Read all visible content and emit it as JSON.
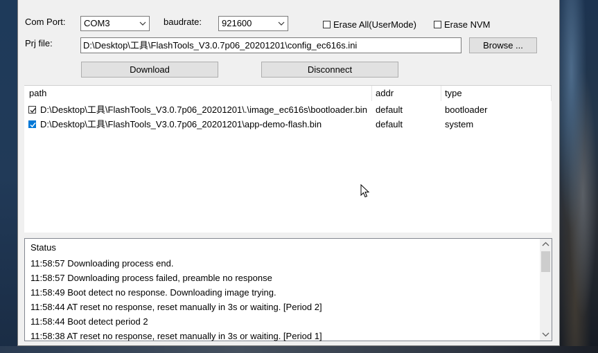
{
  "form": {
    "com_port_label": "Com Port:",
    "com_port_value": "COM3",
    "baudrate_label": "baudrate:",
    "baudrate_value": "921600",
    "erase_all_label": "Erase All(UserMode)",
    "erase_nvm_label": "Erase NVM",
    "prj_file_label": "Prj file:",
    "prj_file_value": "D:\\Desktop\\工具\\FlashTools_V3.0.7p06_20201201\\config_ec616s.ini",
    "browse_label": "Browse ...",
    "download_label": "Download",
    "disconnect_label": "Disconnect"
  },
  "file_list": {
    "columns": [
      "path",
      "addr",
      "type"
    ],
    "rows": [
      {
        "path": "D:\\Desktop\\工具\\FlashTools_V3.0.7p06_20201201\\.\\image_ec616s\\bootloader.bin",
        "addr": "default",
        "type": "bootloader",
        "checked": true
      },
      {
        "path": "D:\\Desktop\\工具\\FlashTools_V3.0.7p06_20201201\\app-demo-flash.bin",
        "addr": "default",
        "type": "system",
        "checked": true
      }
    ]
  },
  "status": {
    "title": "Status",
    "lines": [
      "11:58:57 Downloading process end.",
      "11:58:57 Downloading process failed, preamble no response",
      "11:58:49 Boot detect no response. Downloading image trying.",
      "11:58:44 AT reset no response, reset manually in 3s or waiting. [Period 2]",
      "11:58:44 Boot detect period 2",
      "11:58:38 AT reset no response, reset manually in 3s or waiting. [Period 1]"
    ]
  },
  "colors": {
    "window_bg": "#f0f0f0",
    "checkbox_accent": "#0078d7"
  }
}
